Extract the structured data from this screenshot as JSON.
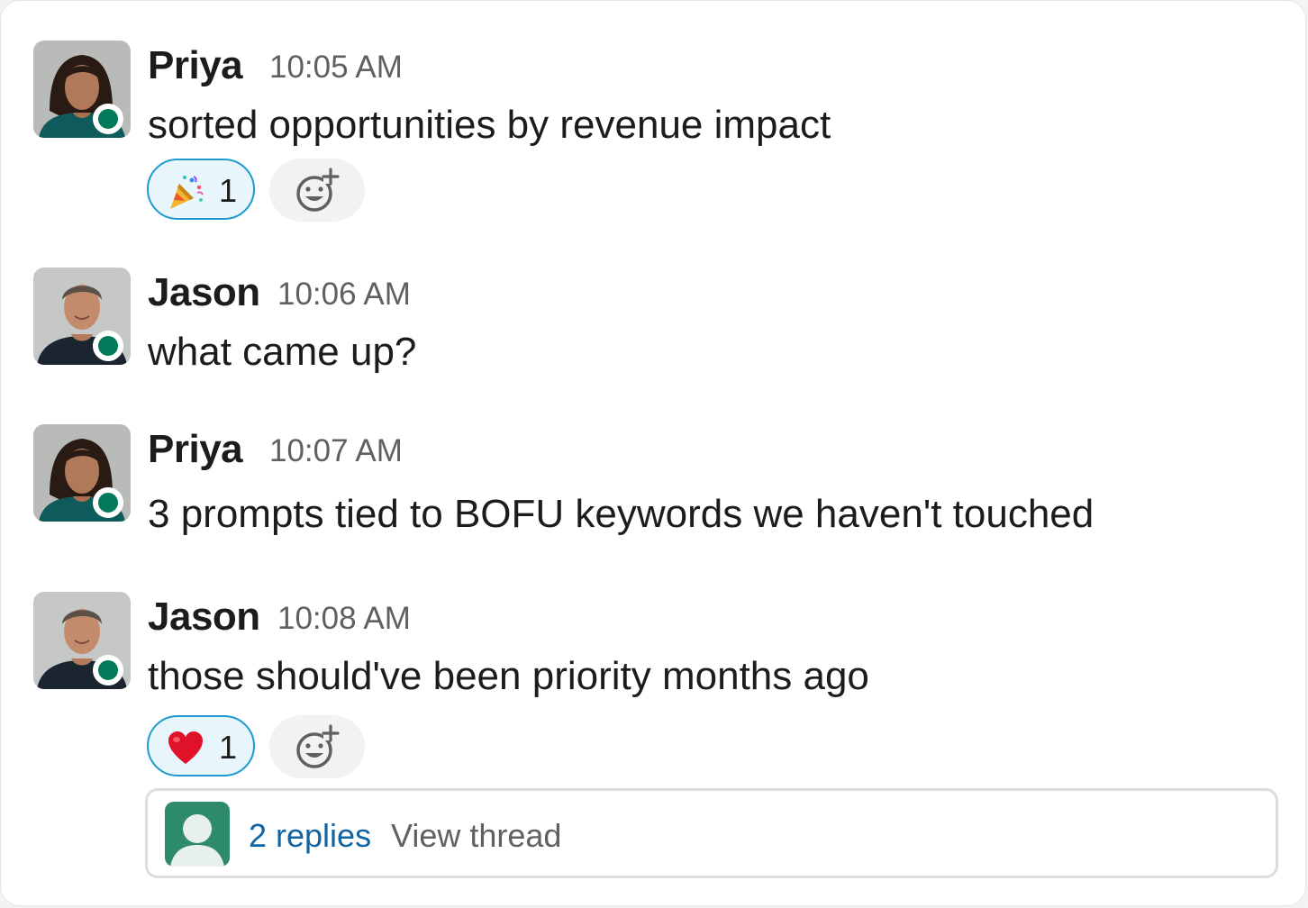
{
  "messages": [
    {
      "author": "Priya",
      "time": "10:05 AM",
      "text": "sorted opportunities by revenue impact",
      "reaction": {
        "emoji": "party-popper",
        "count": "1"
      }
    },
    {
      "author": "Jason",
      "time": "10:06 AM",
      "text": "what came up?"
    },
    {
      "author": "Priya",
      "time": "10:07 AM",
      "text": "3 prompts tied to BOFU keywords we haven't touched"
    },
    {
      "author": "Jason",
      "time": "10:08 AM",
      "text": "those should've been priority months ago",
      "reaction": {
        "emoji": "red-heart",
        "count": "1"
      },
      "thread": {
        "replies": "2 replies",
        "view": "View thread"
      }
    }
  ],
  "colors": {
    "presence": "#007a5a",
    "link": "#1264a3",
    "reaction_border": "#1d9bd1",
    "thread_avatar": "#2e8b6a"
  }
}
